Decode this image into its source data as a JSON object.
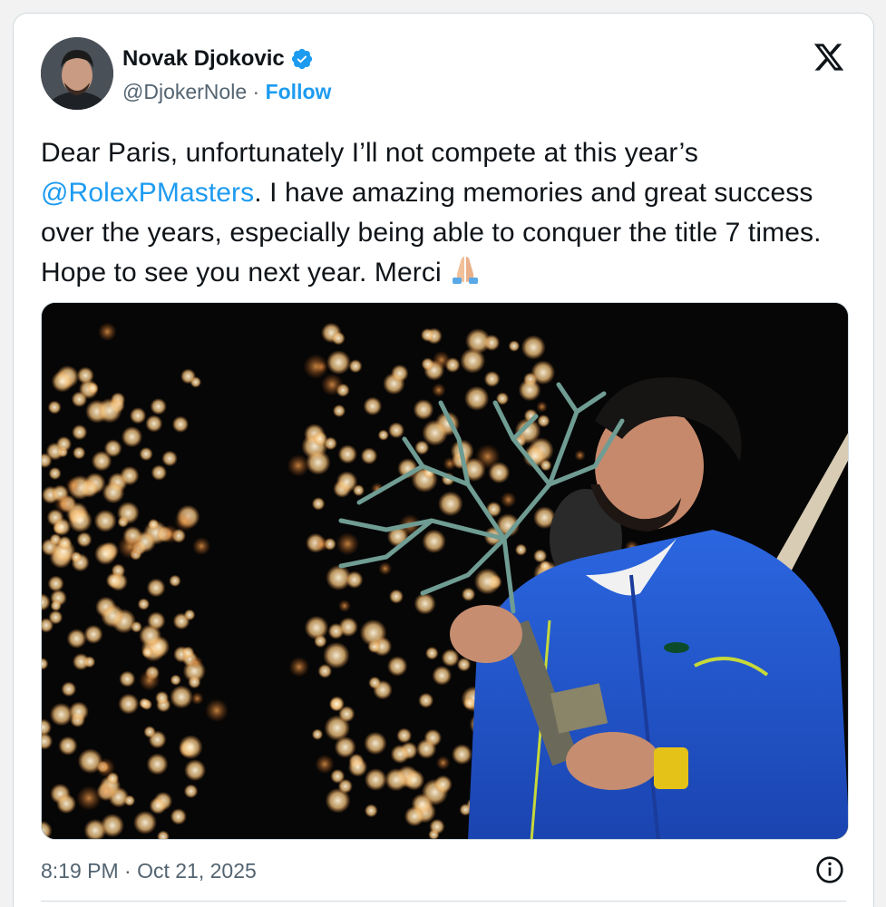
{
  "author": {
    "name": "Novak Djokovic",
    "handle": "@DjokerNole",
    "separator": " · ",
    "follow_label": "Follow",
    "verified_icon": "verified-badge-icon"
  },
  "brand": {
    "icon": "x-logo-icon"
  },
  "tweet": {
    "text_part1": "Dear Paris, unfortunately I’ll not compete at this year’s",
    "mention": "@RolexPMasters",
    "text_part2": ". I have amazing memories and great success over the years, especially being able to conquer the title 7 times. Hope to see you next year. Merci",
    "emoji": "folded-hands-icon"
  },
  "meta": {
    "timestamp": "8:19 PM · Oct 21, 2025",
    "info_icon": "info-icon"
  },
  "colors": {
    "accent": "#1d9bf0",
    "text": "#0f1419",
    "muted": "#536471",
    "border": "#cfd9de"
  }
}
